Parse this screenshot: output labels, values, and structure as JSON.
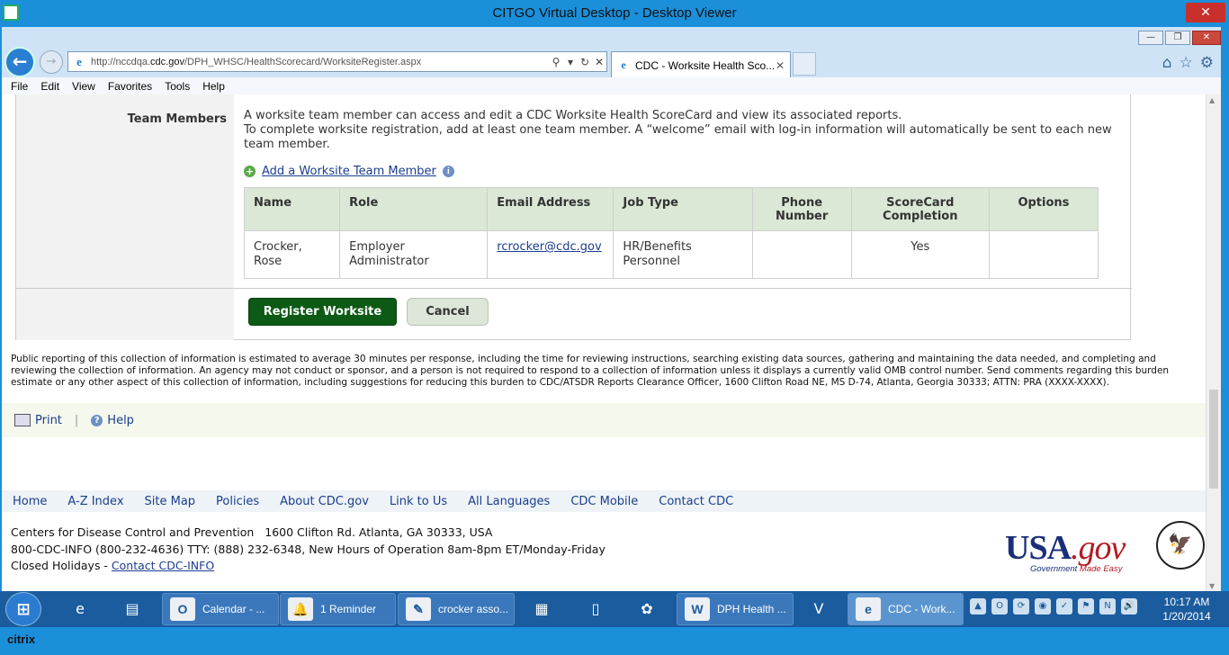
{
  "citrix": {
    "title": "CITGO Virtual Desktop - Desktop Viewer",
    "close": "✕",
    "toolbar_handle": "⠿⠿⠿⠿ 🡓 ⠿⠿⠿⠿",
    "logo": "citrix"
  },
  "browser": {
    "url_prefix": "http://nccdqa.",
    "url_domain": "cdc.gov",
    "url_rest": "/DPH_WHSC/HealthScorecard/WorksiteRegister.aspx",
    "tab_title": "CDC - Worksite Health Sco...",
    "menu": [
      "File",
      "Edit",
      "View",
      "Favorites",
      "Tools",
      "Help"
    ]
  },
  "form": {
    "team_label": "Team Members",
    "desc_line1": "A worksite team member can access and edit a CDC Worksite Health ScoreCard and view its associated reports.",
    "desc_line2": "To complete worksite registration, add at least one team member. A “welcome” email with log-in information will automatically be sent to each new team member.",
    "add_link": "Add a Worksite Team Member",
    "table_headers": [
      "Name",
      "Role",
      "Email Address",
      "Job Type",
      "Phone Number",
      "ScoreCard Completion",
      "Options"
    ],
    "rows": [
      {
        "name": "Crocker, Rose",
        "role": "Employer Administrator",
        "email": "rcrocker@cdc.gov",
        "job": "HR/Benefits Personnel",
        "phone": "",
        "completion": "Yes",
        "options": ""
      }
    ],
    "register_label": "Register Worksite",
    "cancel_label": "Cancel"
  },
  "burden_text": "Public reporting of this collection of information is estimated to average 30 minutes per response, including the time for reviewing instructions, searching existing data sources, gathering and maintaining the data needed, and completing and reviewing the collection of information. An agency may not conduct or sponsor, and a person is not required to respond to a collection of information unless it displays a currently valid OMB control number. Send comments regarding this burden estimate or any other aspect of this collection of information, including suggestions for reducing this burden to CDC/ATSDR Reports Clearance Officer, 1600 Clifton Road NE, MS D-74, Atlanta, Georgia 30333; ATTN: PRA (XXXX-XXXX).",
  "tools": {
    "print": "Print",
    "help": "Help"
  },
  "footer_nav": [
    "Home",
    "A-Z Index",
    "Site Map",
    "Policies",
    "About CDC.gov",
    "Link to Us",
    "All Languages",
    "CDC Mobile",
    "Contact CDC"
  ],
  "footer": {
    "line1": "Centers for Disease Control and Prevention   1600 Clifton Rd. Atlanta, GA 30333, USA",
    "line2": "800-CDC-INFO (800-232-4636) TTY: (888) 232-6348, New Hours of Operation 8am-8pm ET/Monday-Friday",
    "line3_prefix": "Closed Holidays - ",
    "line3_link": "Contact CDC-INFO"
  },
  "usagov": {
    "usa": "USA",
    "gov": ".gov",
    "tag1": "Government ",
    "tag2": "Made Easy"
  },
  "taskbar": {
    "calendar": "Calendar - ...",
    "reminder": "1 Reminder",
    "crocker": "crocker asso...",
    "dph": "DPH Health ...",
    "cdc": "CDC - Work...",
    "time": "10:17 AM",
    "date": "1/20/2014"
  }
}
